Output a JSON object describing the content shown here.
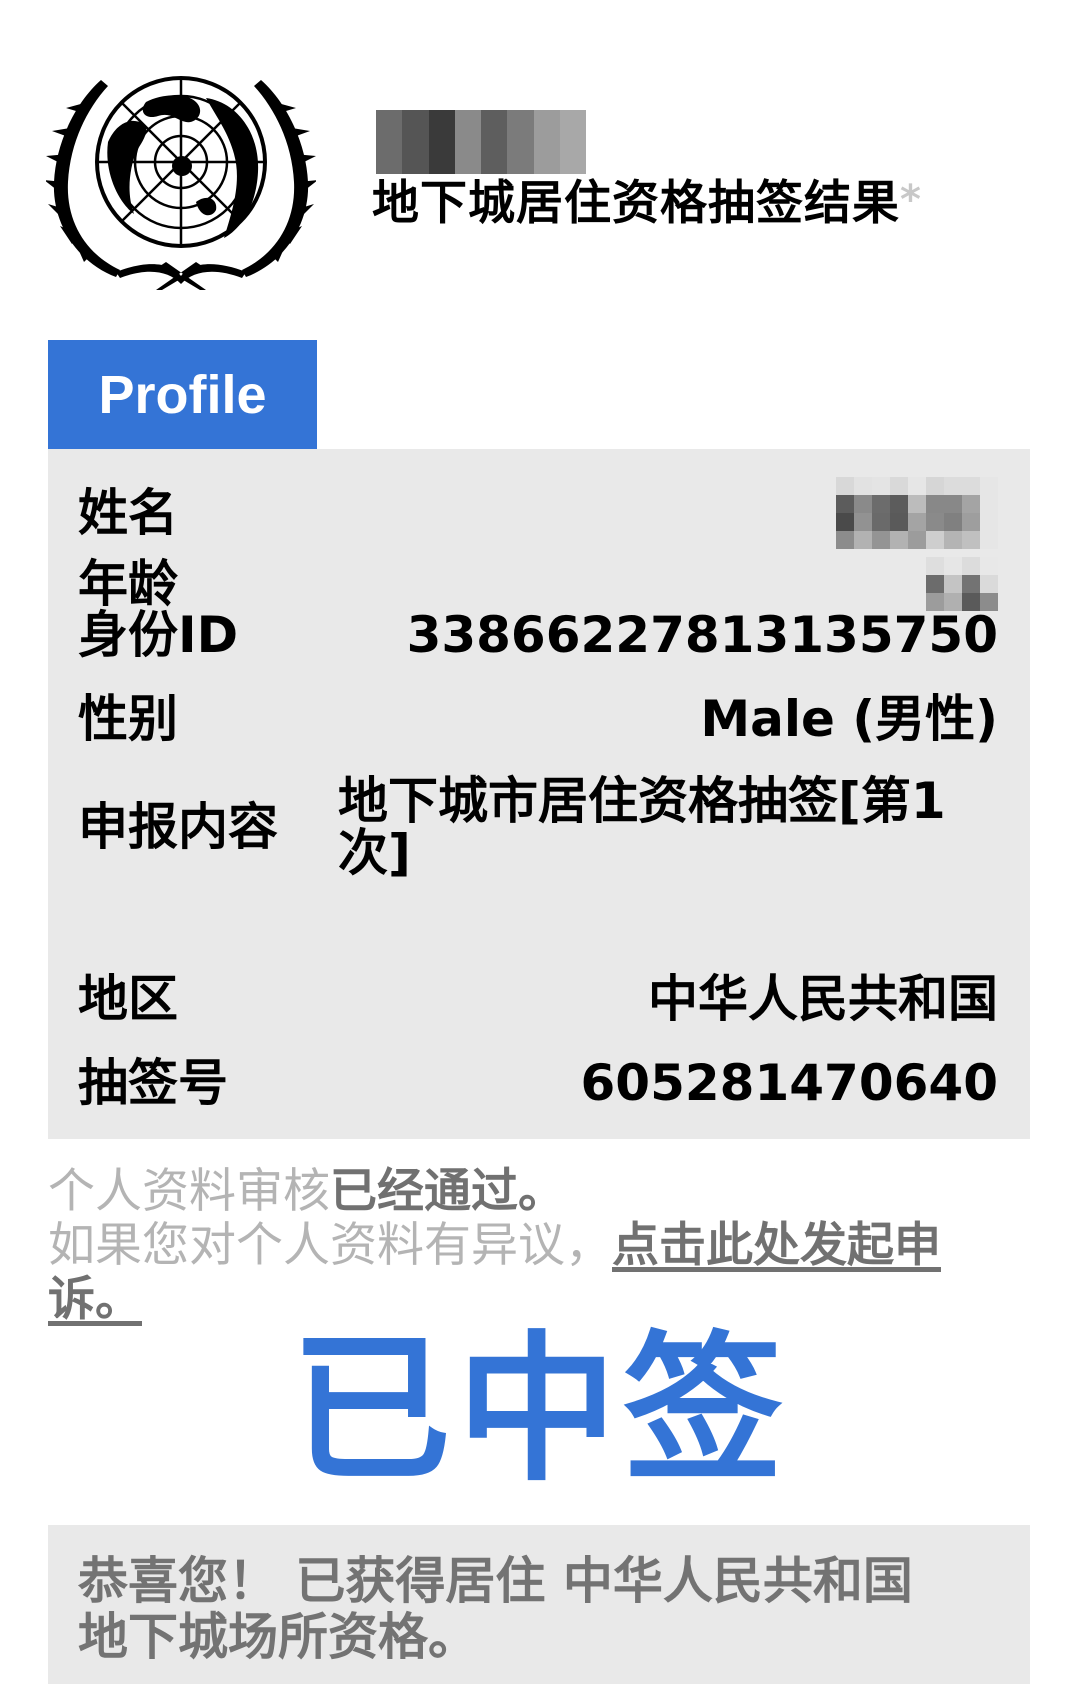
{
  "header": {
    "emblem": "un-emblem-icon",
    "redacted_prefix": "[pixelated]",
    "title": "地下城居住资格抽签结果",
    "title_marker": "*"
  },
  "profile": {
    "tab_label": "Profile",
    "fields": [
      {
        "label": "姓名",
        "value": null,
        "redacted": true
      },
      {
        "label": "年龄",
        "value": null,
        "redacted": true
      },
      {
        "label": "身份ID",
        "value": "33866227813135750"
      },
      {
        "label": "性别",
        "value": "Male (男性)"
      },
      {
        "label": "申报内容",
        "value": "地下城市居住资格抽签[第1次]"
      },
      {
        "label": "地区",
        "value": "中华人民共和国"
      },
      {
        "label": "抽签号",
        "value": "605281470640"
      }
    ]
  },
  "notice": {
    "line1_plain": "个人资料审核",
    "line1_bold": "已经通过。",
    "line2_plain": "如果您对个人资料有异议，",
    "appeal_link": "点击此处发起申诉。"
  },
  "result": {
    "status": "已中签",
    "congrats": "恭喜您！ 已获得居住 中华人民共和国 地下城场所资格。"
  },
  "colors": {
    "accent": "#3474d6",
    "panel": "#e9e9e9",
    "muted_text": "#b4b4b4",
    "dark_muted": "#737373"
  }
}
